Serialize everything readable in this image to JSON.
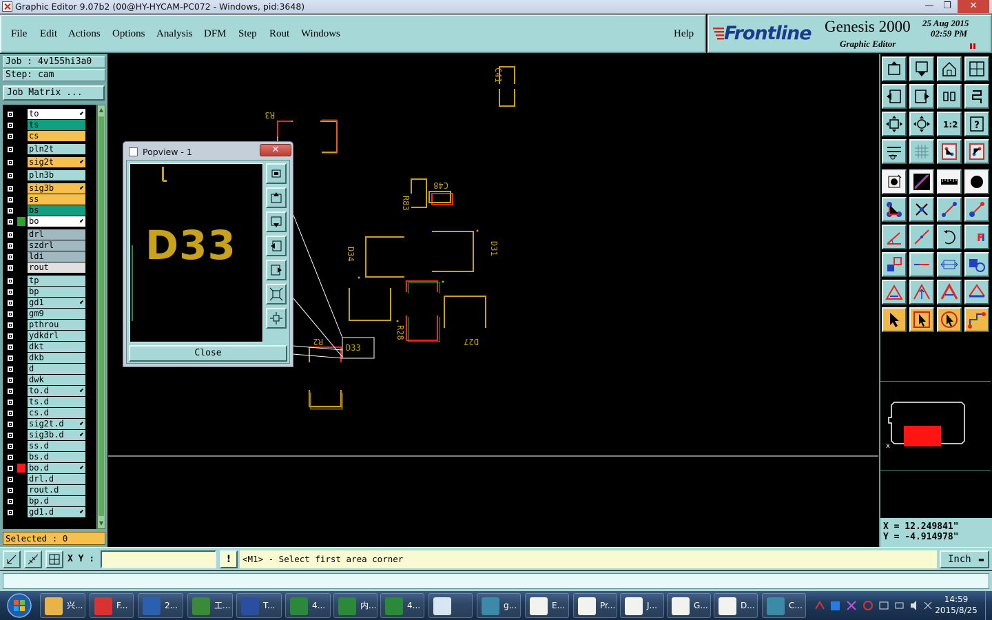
{
  "window": {
    "title": "Graphic Editor 9.07b2 (00@HY-HYCAM-PC072 - Windows, pid:3648)",
    "minimize_label": "—",
    "maximize_label": "❐",
    "close_label": "✕"
  },
  "menu": {
    "items": [
      "File",
      "Edit",
      "Actions",
      "Options",
      "Analysis",
      "DFM",
      "Step",
      "Rout",
      "Windows"
    ],
    "help": "Help"
  },
  "brand": {
    "logo": "Frontline",
    "product": "Genesis 2000",
    "subtitle": "Graphic Editor",
    "date": "25 Aug 2015",
    "time": "02:59 PM"
  },
  "job": {
    "job_line": "Job : 4v155hi3a0",
    "step_line": "Step: cam",
    "matrix_button": "Job Matrix ..."
  },
  "layers": [
    {
      "name": "to",
      "color": "#ffffff",
      "arrow": true
    },
    {
      "name": "ts",
      "color": "#10a080",
      "arrow": false
    },
    {
      "name": "cs",
      "color": "#f5c04e",
      "arrow": false
    },
    {
      "name": "pln2t",
      "color": "#a6d8d8",
      "arrow": false
    },
    {
      "name": "sig2t",
      "color": "#f5c04e",
      "arrow": true
    },
    {
      "name": "pln3b",
      "color": "#a6d8d8",
      "arrow": false
    },
    {
      "name": "sig3b",
      "color": "#f5c04e",
      "arrow": true
    },
    {
      "name": "ss",
      "color": "#f5c04e",
      "arrow": false
    },
    {
      "name": "bs",
      "color": "#10a080",
      "arrow": false
    },
    {
      "name": "bo",
      "color": "#ffffff",
      "arrow": true,
      "mark": "#2aa52a"
    },
    {
      "name": "drl",
      "color": "#a0b8c0",
      "arrow": false
    },
    {
      "name": "szdrl",
      "color": "#a0b8c0",
      "arrow": false
    },
    {
      "name": "ldi",
      "color": "#a0b8c0",
      "arrow": false
    },
    {
      "name": "rout",
      "color": "#e0e0e0",
      "arrow": false
    },
    {
      "name": "tp",
      "color": "#a6d8d8",
      "arrow": false
    },
    {
      "name": "bp",
      "color": "#a6d8d8",
      "arrow": false
    },
    {
      "name": "gd1",
      "color": "#a6d8d8",
      "arrow": true
    },
    {
      "name": "gm9",
      "color": "#a6d8d8",
      "arrow": false
    },
    {
      "name": "pthrou",
      "color": "#a6d8d8",
      "arrow": false
    },
    {
      "name": "ydkdrl",
      "color": "#a6d8d8",
      "arrow": false
    },
    {
      "name": "dkt",
      "color": "#a6d8d8",
      "arrow": false
    },
    {
      "name": "dkb",
      "color": "#a6d8d8",
      "arrow": false
    },
    {
      "name": "d",
      "color": "#a6d8d8",
      "arrow": false
    },
    {
      "name": "dwk",
      "color": "#a6d8d8",
      "arrow": false
    },
    {
      "name": "to.d",
      "color": "#a6d8d8",
      "arrow": true
    },
    {
      "name": "ts.d",
      "color": "#a6d8d8",
      "arrow": false
    },
    {
      "name": "cs.d",
      "color": "#a6d8d8",
      "arrow": false
    },
    {
      "name": "sig2t.d",
      "color": "#a6d8d8",
      "arrow": true
    },
    {
      "name": "sig3b.d",
      "color": "#a6d8d8",
      "arrow": true
    },
    {
      "name": "ss.d",
      "color": "#a6d8d8",
      "arrow": false
    },
    {
      "name": "bs.d",
      "color": "#a6d8d8",
      "arrow": false
    },
    {
      "name": "bo.d",
      "color": "#a6d8d8",
      "arrow": true,
      "mark": "#ff1a1a",
      "active": true
    },
    {
      "name": "drl.d",
      "color": "#a6d8d8",
      "arrow": false
    },
    {
      "name": "rout.d",
      "color": "#a6d8d8",
      "arrow": false
    },
    {
      "name": "bp.d",
      "color": "#a6d8d8",
      "arrow": false
    },
    {
      "name": "gd1.d",
      "color": "#a6d8d8",
      "arrow": true
    }
  ],
  "selected": "Selected : 0",
  "canvas": {
    "labels": [
      "C41",
      "R3",
      "C48",
      "R83",
      "D34",
      "D31",
      "R28",
      "D27",
      "R2",
      "D33"
    ]
  },
  "popview": {
    "title": "Popview - 1",
    "zoom_label": "D33",
    "close_button": "Close",
    "close_x": "✕"
  },
  "coords": {
    "x": "X = 12.249841\"",
    "y": "Y = -4.914978\""
  },
  "command": {
    "xy_label": "X Y :",
    "xy_value": "",
    "alert_icon": "!",
    "prompt": "<M1> - Select first area corner",
    "unit": "Inch"
  },
  "taskbar": {
    "items": [
      "兴...",
      "F...",
      "2...",
      "工...",
      "T...",
      "4...",
      "内...",
      "4...",
      "",
      "g...",
      "E...",
      "Pr...",
      "J...",
      "G...",
      "D...",
      "C..."
    ],
    "time": "14:59",
    "date": "2015/8/25"
  },
  "colors": {
    "panel": "#a6d8d8",
    "pad": "#c8a21c",
    "highlight_red": "#ff2020",
    "highlight_green": "#30c030"
  }
}
